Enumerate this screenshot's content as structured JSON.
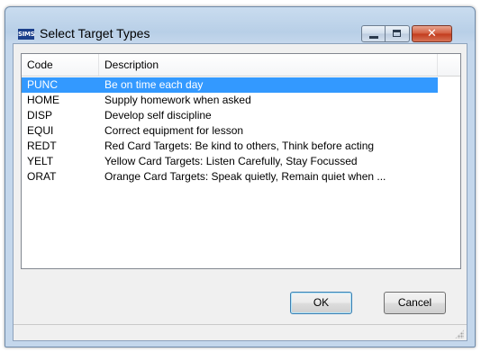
{
  "window": {
    "title": "Select Target Types",
    "icon_text": "SIMS",
    "controls": [
      "minimize-icon",
      "maximize-icon",
      "close-icon"
    ]
  },
  "list": {
    "columns": [
      "Code",
      "Description"
    ],
    "rows": [
      {
        "code": "PUNC",
        "description": "Be on time each day",
        "selected": true
      },
      {
        "code": "HOME",
        "description": "Supply homework when asked"
      },
      {
        "code": "DISP",
        "description": "Develop self discipline"
      },
      {
        "code": "EQUI",
        "description": "Correct equipment for lesson"
      },
      {
        "code": "REDT",
        "description": "Red Card Targets: Be kind to others, Think before acting"
      },
      {
        "code": "YELT",
        "description": "Yellow Card Targets: Listen Carefully, Stay Focussed"
      },
      {
        "code": "ORAT",
        "description": "Orange Card Targets: Speak quietly, Remain quiet when ..."
      }
    ]
  },
  "buttons": {
    "ok": "OK",
    "cancel": "Cancel"
  },
  "colors": {
    "selection": "#3399ff"
  }
}
